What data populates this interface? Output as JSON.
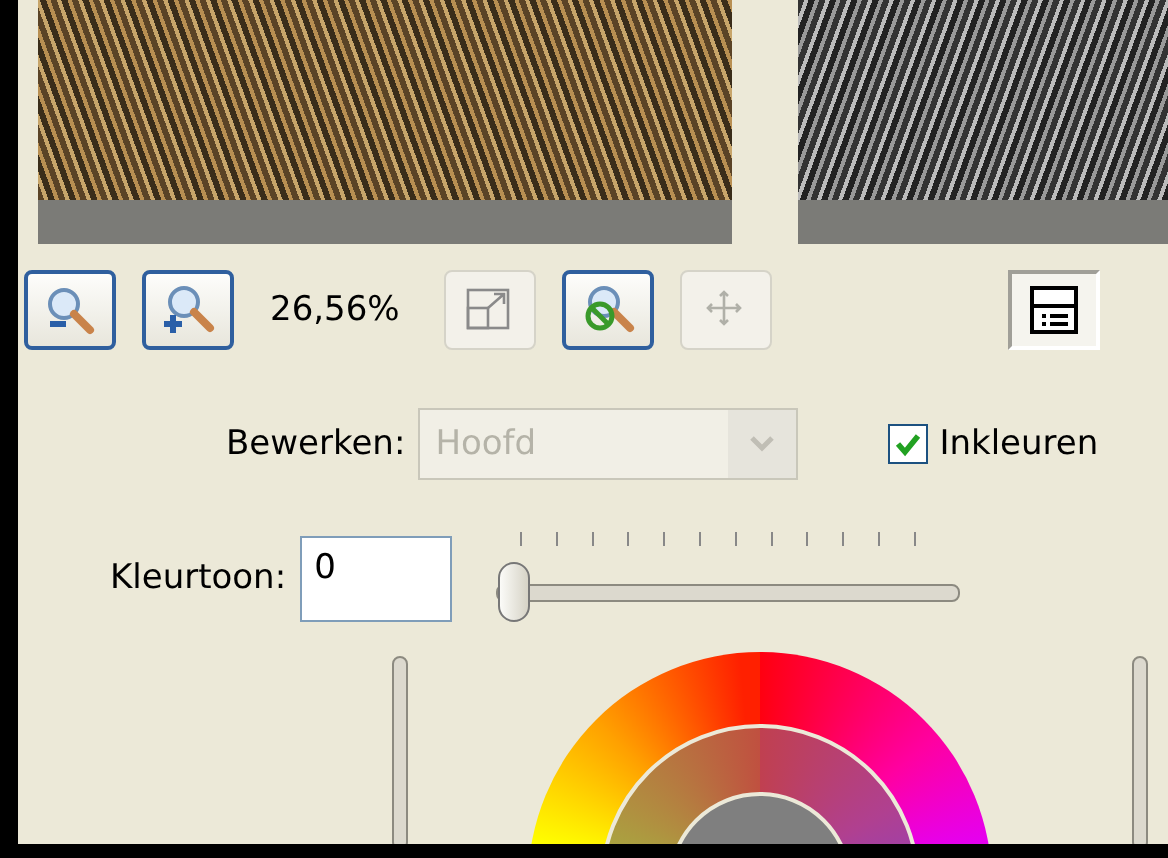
{
  "previews": [
    {
      "kind": "color"
    },
    {
      "kind": "gray"
    }
  ],
  "toolbar": {
    "buttons": [
      {
        "kind": "zoom-out",
        "disabled": false,
        "pressed": false
      },
      {
        "kind": "zoom-in",
        "disabled": false,
        "pressed": false
      },
      {
        "kind": "fit",
        "disabled": true,
        "pressed": false
      },
      {
        "kind": "no-zoom",
        "disabled": false,
        "pressed": false
      },
      {
        "kind": "move",
        "disabled": true,
        "pressed": false
      },
      {
        "kind": "layout",
        "disabled": false,
        "pressed": true
      }
    ],
    "zoom_text": "26,56%"
  },
  "edit": {
    "label": "Bewerken:",
    "value": "Hoofd",
    "disabled": true
  },
  "colorize": {
    "label": "Inkleuren",
    "checked": true
  },
  "hue": {
    "label": "Kleurtoon:",
    "value": "0",
    "level": 0
  }
}
